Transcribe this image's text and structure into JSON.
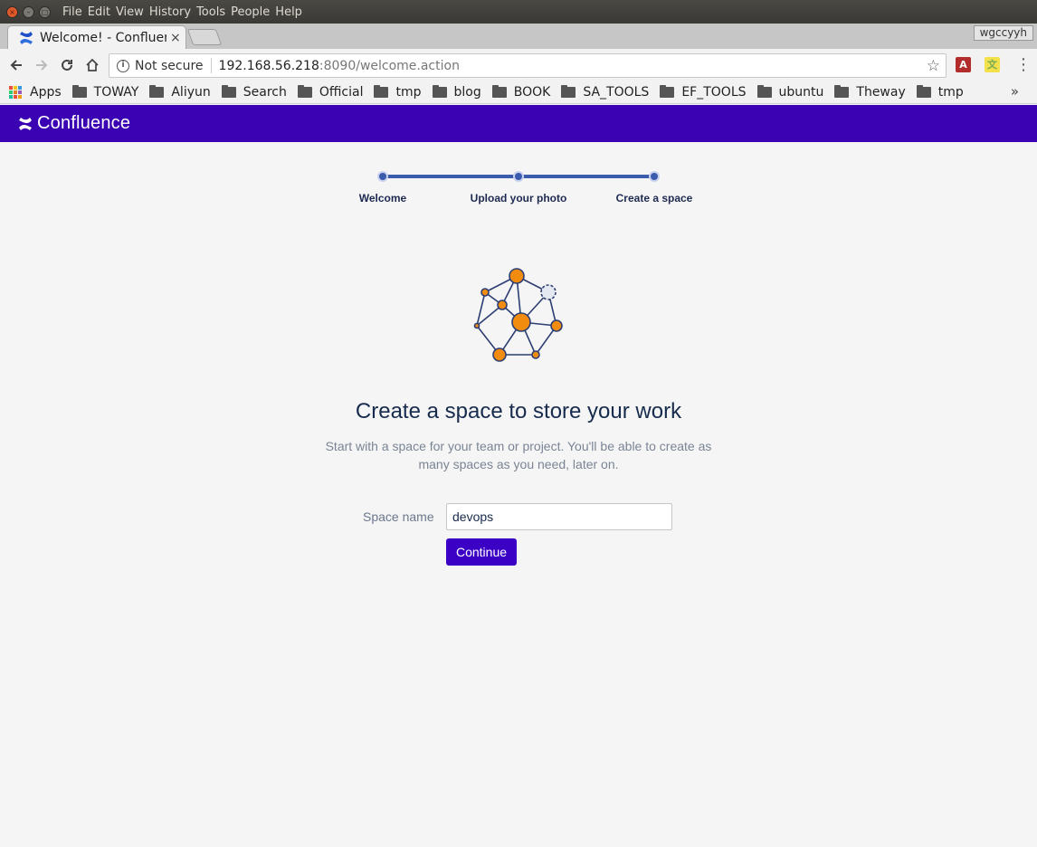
{
  "os_menu": [
    "File",
    "Edit",
    "View",
    "History",
    "Tools",
    "People",
    "Help"
  ],
  "tab": {
    "title": "Welcome! - Confluence",
    "close": "×"
  },
  "profile": "wgccyyh",
  "address": {
    "security": "Not secure",
    "host": "192.168.56.218",
    "path": ":8090/welcome.action"
  },
  "bookmarks": [
    "Apps",
    "TOWAY",
    "Aliyun",
    "Search",
    "Official",
    "tmp",
    "blog",
    "BOOK",
    "SA_TOOLS",
    "EF_TOOLS",
    "ubuntu",
    "Theway",
    "tmp"
  ],
  "app": {
    "brand": "Confluence",
    "brand_color": "#3a02b3",
    "accent": "#3b5bac"
  },
  "steps": [
    "Welcome",
    "Upload your photo",
    "Create a space"
  ],
  "heading": "Create a space to store your work",
  "description": "Start with a space for your team or project. You'll be able to create as many spaces as you need, later on.",
  "form": {
    "label": "Space name",
    "value": "devops",
    "button": "Continue"
  },
  "icons": {
    "back": "arrow-left-icon",
    "forward": "arrow-right-icon",
    "reload": "reload-icon",
    "home": "home-icon",
    "bookmark": "star-icon",
    "menu": "kebab-menu-icon"
  }
}
